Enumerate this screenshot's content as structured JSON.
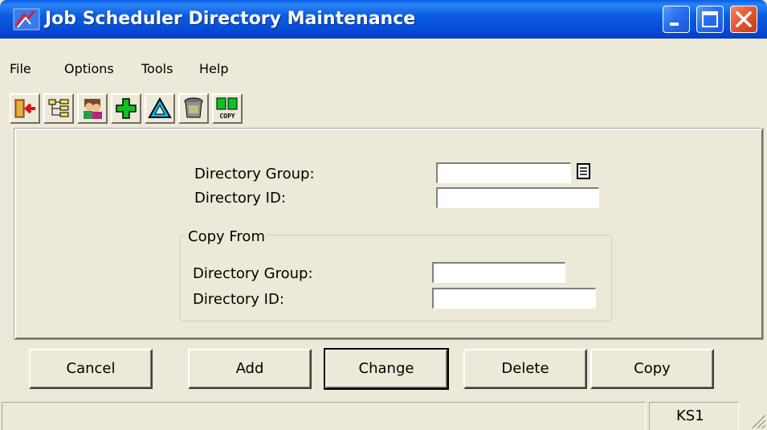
{
  "window": {
    "title": "Job Scheduler Directory Maintenance",
    "colors": {
      "titlebar": "#0347d4",
      "face": "#ece9d8",
      "close": "#e25a36"
    }
  },
  "menu": [
    {
      "label": "File"
    },
    {
      "label": "Options"
    },
    {
      "label": "Tools"
    },
    {
      "label": "Help"
    }
  ],
  "toolbar": {
    "icons": [
      "exit-icon",
      "tree-icon",
      "people-icon",
      "add-icon",
      "change-icon",
      "delete-icon",
      "copy-icon"
    ],
    "copy_icon_text": "COPY"
  },
  "form": {
    "directory_group_label": "Directory Group:",
    "directory_id_label": "Directory ID:",
    "directory_group_value": "",
    "directory_id_value": "",
    "copy_from": {
      "title": "Copy From",
      "directory_group_label": "Directory Group:",
      "directory_id_label": "Directory ID:",
      "directory_group_value": "",
      "directory_id_value": ""
    }
  },
  "buttons": {
    "cancel": "Cancel",
    "add": "Add",
    "change": "Change",
    "delete": "Delete",
    "copy": "Copy"
  },
  "status": {
    "main": "",
    "code": "KS1"
  }
}
